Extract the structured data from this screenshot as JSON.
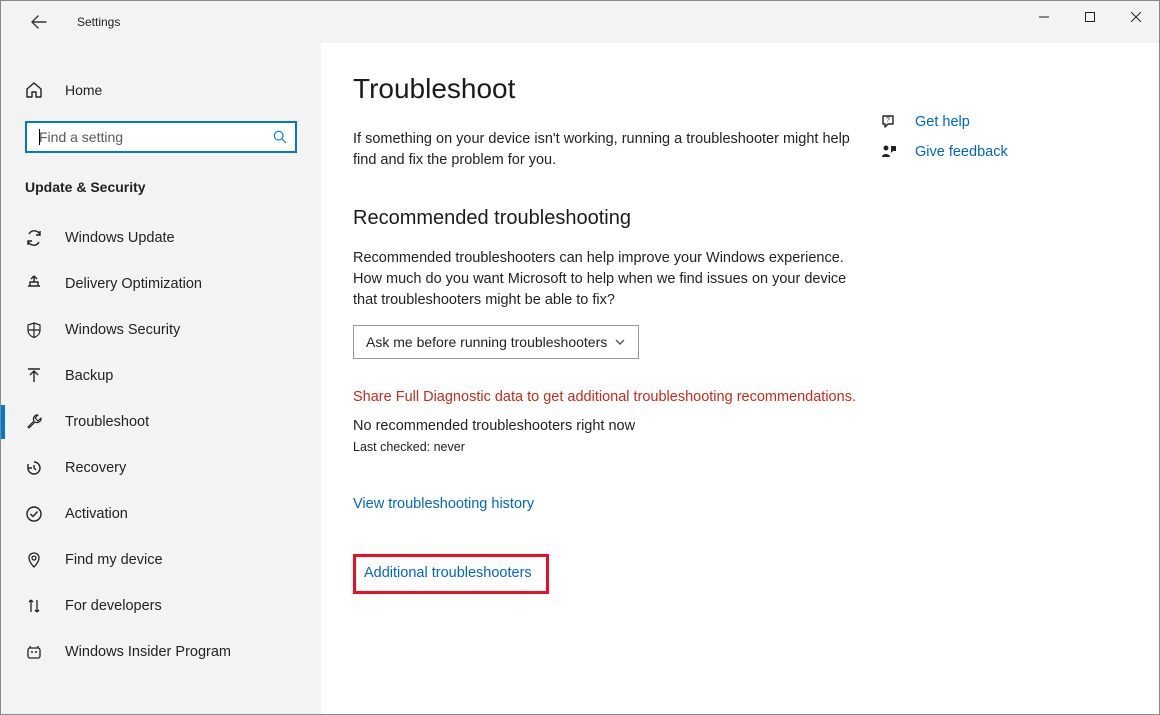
{
  "window": {
    "title": "Settings"
  },
  "sidebar": {
    "home": "Home",
    "search_placeholder": "Find a setting",
    "category": "Update & Security",
    "items": [
      {
        "icon": "sync-icon",
        "label": "Windows Update"
      },
      {
        "icon": "delivery-icon",
        "label": "Delivery Optimization"
      },
      {
        "icon": "shield-icon",
        "label": "Windows Security"
      },
      {
        "icon": "backup-icon",
        "label": "Backup"
      },
      {
        "icon": "wrench-icon",
        "label": "Troubleshoot",
        "active": true
      },
      {
        "icon": "recovery-icon",
        "label": "Recovery"
      },
      {
        "icon": "check-circle-icon",
        "label": "Activation"
      },
      {
        "icon": "find-device-icon",
        "label": "Find my device"
      },
      {
        "icon": "dev-icon",
        "label": "For developers"
      },
      {
        "icon": "insider-icon",
        "label": "Windows Insider Program"
      }
    ]
  },
  "main": {
    "title": "Troubleshoot",
    "intro": "If something on your device isn't working, running a troubleshooter might help find and fix the problem for you.",
    "section_title": "Recommended troubleshooting",
    "section_desc": "Recommended troubleshooters can help improve your Windows experience. How much do you want Microsoft to help when we find issues on your device that troubleshooters might be able to fix?",
    "dropdown_value": "Ask me before running troubleshooters",
    "warning": "Share Full Diagnostic data to get additional troubleshooting recommendations.",
    "status": "No recommended troubleshooters right now",
    "last_checked": "Last checked: never",
    "history_link": "View troubleshooting history",
    "additional_link": "Additional troubleshooters"
  },
  "help": {
    "get_help": "Get help",
    "feedback": "Give feedback"
  }
}
